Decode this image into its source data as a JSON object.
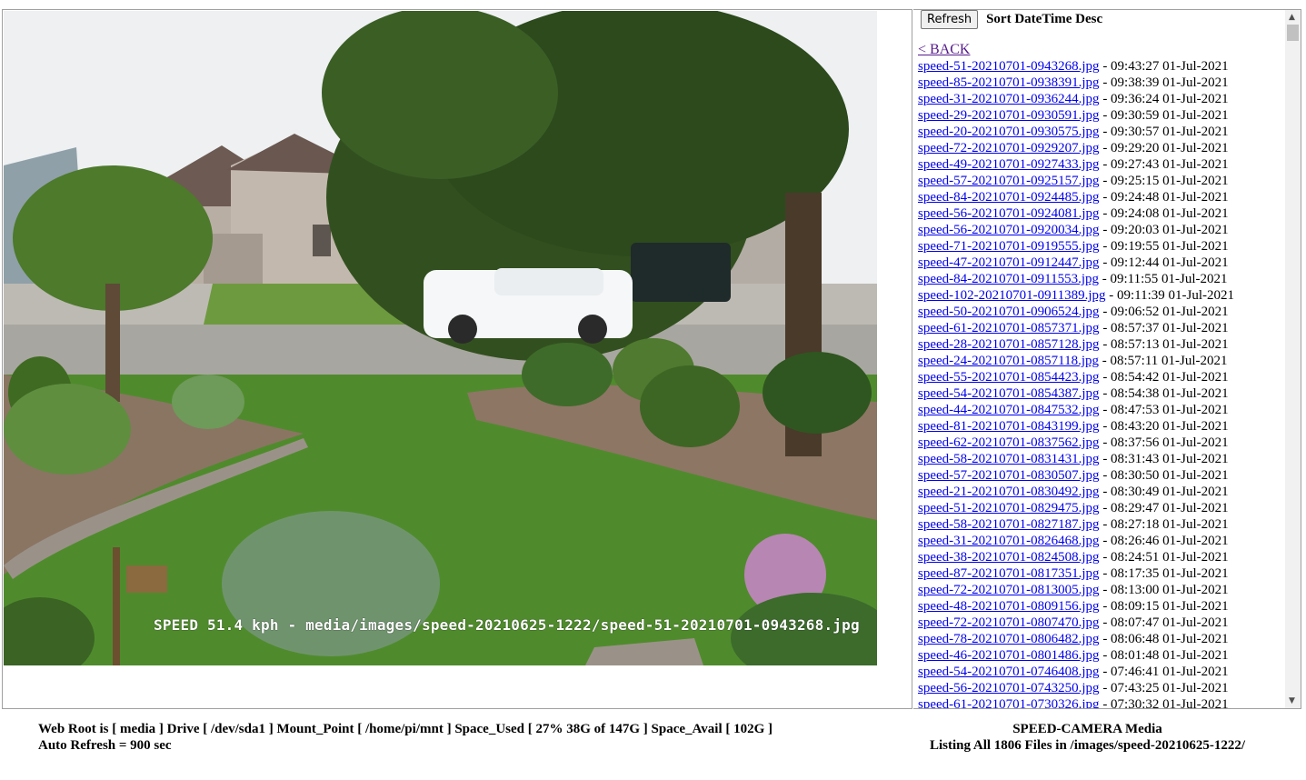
{
  "image_panel": {
    "overlay_text": "SPEED 51.4 kph - media/images/speed-20210625-1222/speed-51-20210701-0943268.jpg",
    "scene": "front yard with lawn, trees, hostas and a white SUV passing on the street"
  },
  "toolbar": {
    "refresh_label": "Refresh",
    "sort_label": "Sort DateTime Desc"
  },
  "back_link": "< BACK",
  "files": [
    {
      "name": "speed-51-20210701-0943268.jpg",
      "time": " - 09:43:27 01-Jul-2021"
    },
    {
      "name": "speed-85-20210701-0938391.jpg",
      "time": " - 09:38:39 01-Jul-2021"
    },
    {
      "name": "speed-31-20210701-0936244.jpg",
      "time": " - 09:36:24 01-Jul-2021"
    },
    {
      "name": "speed-29-20210701-0930591.jpg",
      "time": " - 09:30:59 01-Jul-2021"
    },
    {
      "name": "speed-20-20210701-0930575.jpg",
      "time": " - 09:30:57 01-Jul-2021"
    },
    {
      "name": "speed-72-20210701-0929207.jpg",
      "time": " - 09:29:20 01-Jul-2021"
    },
    {
      "name": "speed-49-20210701-0927433.jpg",
      "time": " - 09:27:43 01-Jul-2021"
    },
    {
      "name": "speed-57-20210701-0925157.jpg",
      "time": " - 09:25:15 01-Jul-2021"
    },
    {
      "name": "speed-84-20210701-0924485.jpg",
      "time": " - 09:24:48 01-Jul-2021"
    },
    {
      "name": "speed-56-20210701-0924081.jpg",
      "time": " - 09:24:08 01-Jul-2021"
    },
    {
      "name": "speed-56-20210701-0920034.jpg",
      "time": " - 09:20:03 01-Jul-2021"
    },
    {
      "name": "speed-71-20210701-0919555.jpg",
      "time": " - 09:19:55 01-Jul-2021"
    },
    {
      "name": "speed-47-20210701-0912447.jpg",
      "time": " - 09:12:44 01-Jul-2021"
    },
    {
      "name": "speed-84-20210701-0911553.jpg",
      "time": " - 09:11:55 01-Jul-2021"
    },
    {
      "name": "speed-102-20210701-0911389.jpg",
      "time": " - 09:11:39 01-Jul-2021"
    },
    {
      "name": "speed-50-20210701-0906524.jpg",
      "time": " - 09:06:52 01-Jul-2021"
    },
    {
      "name": "speed-61-20210701-0857371.jpg",
      "time": " - 08:57:37 01-Jul-2021"
    },
    {
      "name": "speed-28-20210701-0857128.jpg",
      "time": " - 08:57:13 01-Jul-2021"
    },
    {
      "name": "speed-24-20210701-0857118.jpg",
      "time": " - 08:57:11 01-Jul-2021"
    },
    {
      "name": "speed-55-20210701-0854423.jpg",
      "time": " - 08:54:42 01-Jul-2021"
    },
    {
      "name": "speed-54-20210701-0854387.jpg",
      "time": " - 08:54:38 01-Jul-2021"
    },
    {
      "name": "speed-44-20210701-0847532.jpg",
      "time": " - 08:47:53 01-Jul-2021"
    },
    {
      "name": "speed-81-20210701-0843199.jpg",
      "time": " - 08:43:20 01-Jul-2021"
    },
    {
      "name": "speed-62-20210701-0837562.jpg",
      "time": " - 08:37:56 01-Jul-2021"
    },
    {
      "name": "speed-58-20210701-0831431.jpg",
      "time": " - 08:31:43 01-Jul-2021"
    },
    {
      "name": "speed-57-20210701-0830507.jpg",
      "time": " - 08:30:50 01-Jul-2021"
    },
    {
      "name": "speed-21-20210701-0830492.jpg",
      "time": " - 08:30:49 01-Jul-2021"
    },
    {
      "name": "speed-51-20210701-0829475.jpg",
      "time": " - 08:29:47 01-Jul-2021"
    },
    {
      "name": "speed-58-20210701-0827187.jpg",
      "time": " - 08:27:18 01-Jul-2021"
    },
    {
      "name": "speed-31-20210701-0826468.jpg",
      "time": " - 08:26:46 01-Jul-2021"
    },
    {
      "name": "speed-38-20210701-0824508.jpg",
      "time": " - 08:24:51 01-Jul-2021"
    },
    {
      "name": "speed-87-20210701-0817351.jpg",
      "time": " - 08:17:35 01-Jul-2021"
    },
    {
      "name": "speed-72-20210701-0813005.jpg",
      "time": " - 08:13:00 01-Jul-2021"
    },
    {
      "name": "speed-48-20210701-0809156.jpg",
      "time": " - 08:09:15 01-Jul-2021"
    },
    {
      "name": "speed-72-20210701-0807470.jpg",
      "time": " - 08:07:47 01-Jul-2021"
    },
    {
      "name": "speed-78-20210701-0806482.jpg",
      "time": " - 08:06:48 01-Jul-2021"
    },
    {
      "name": "speed-46-20210701-0801486.jpg",
      "time": " - 08:01:48 01-Jul-2021"
    },
    {
      "name": "speed-54-20210701-0746408.jpg",
      "time": " - 07:46:41 01-Jul-2021"
    },
    {
      "name": "speed-56-20210701-0743250.jpg",
      "time": " - 07:43:25 01-Jul-2021"
    },
    {
      "name": "speed-61-20210701-0730326.jpg",
      "time": " - 07:30:32 01-Jul-2021"
    }
  ],
  "footer": {
    "left_line1": "Web Root is [ media ] Drive [ /dev/sda1 ] Mount_Point [ /home/pi/mnt ] Space_Used [ 27% 38G of 147G ] Space_Avail [ 102G ]",
    "left_line2": "Auto Refresh = 900 sec",
    "right_line1": "SPEED-CAMERA Media",
    "right_line2": "Listing All 1806 Files in /images/speed-20210625-1222/"
  },
  "colors": {
    "link": "#0000ee",
    "visited_link": "#551a8b"
  }
}
